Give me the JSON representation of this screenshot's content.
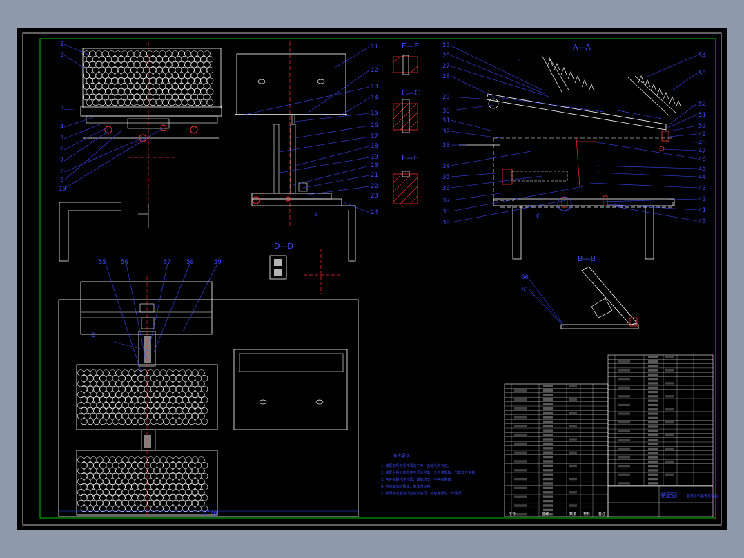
{
  "drawing": {
    "part_labels_left": [
      "1",
      "2",
      "3",
      "4",
      "5",
      "6",
      "7",
      "8",
      "9",
      "10"
    ],
    "part_labels_mid": [
      "11",
      "12",
      "13",
      "14",
      "15",
      "16",
      "17",
      "18",
      "19",
      "20",
      "21",
      "22",
      "23",
      "24"
    ],
    "part_labels_right_left": [
      "25",
      "26",
      "27",
      "28",
      "29",
      "30",
      "31",
      "32",
      "33",
      "34",
      "35",
      "36",
      "37",
      "38",
      "39"
    ],
    "part_labels_right_right": [
      "54",
      "53",
      "52",
      "51",
      "50",
      "49",
      "48",
      "47",
      "46",
      "45",
      "44",
      "43",
      "42",
      "41",
      "40"
    ],
    "plan_labels": [
      "55",
      "56",
      "57",
      "58",
      "59"
    ],
    "section_titles": {
      "aa": "A—A",
      "bb": "B—B",
      "cc": "C—C",
      "dd": "D—D",
      "ee": "E—E",
      "ff": "F—F"
    },
    "view_markers": {
      "f": "F",
      "e": "E",
      "d": "D",
      "c": "C",
      "b": "B"
    },
    "bb_labels": [
      "60",
      "61"
    ],
    "dimension": "1770",
    "notes_title": "技术要求",
    "notes": [
      "1. 装配前所有零件清洗干净，去除毛刺飞边。",
      "2. 装配后各运动部件应灵活可靠，无卡滞现象，气缸动作平稳。",
      "3. 各连接螺栓应拧紧，焊缝均匀，不得有裂纹。",
      "4. 外表面涂防锈漆，面漆为灰色。",
      "5. 装配完成后进行空载试运行，检查各部位工作情况。"
    ],
    "title_block": {
      "name_line1": "装配图",
      "name_line2": "自动上料装置总装图",
      "footer_left": "序号",
      "footer_mid": "名称",
      "footer_qty": "数量",
      "footer_mat": "材料",
      "footer_note": "备注"
    }
  }
}
